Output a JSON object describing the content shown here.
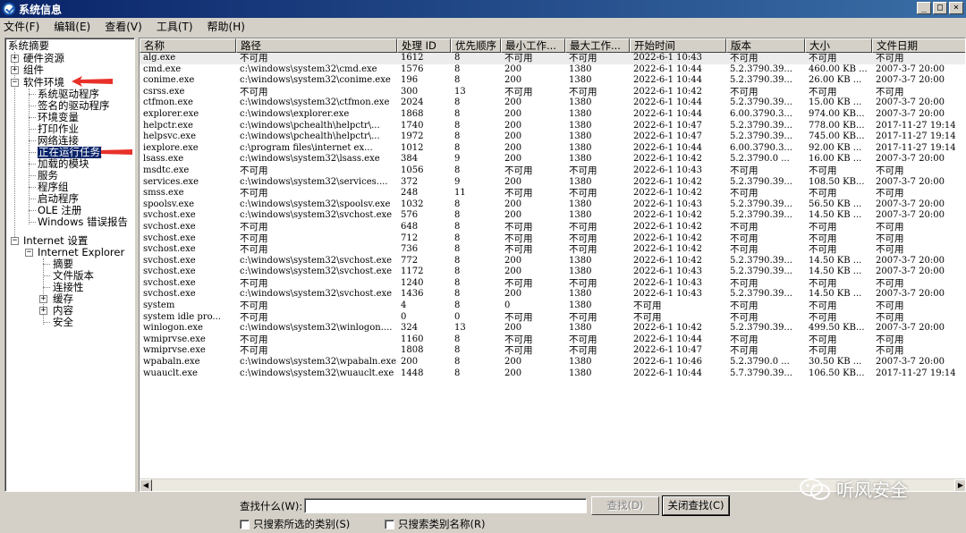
{
  "window": {
    "title": "系统信息"
  },
  "menu": [
    "文件(F)",
    "编辑(E)",
    "查看(V)",
    "工具(T)",
    "帮助(H)"
  ],
  "tree": {
    "root": "系统摘要",
    "hardware": "硬件资源",
    "components": "组件",
    "software_env": "软件环境",
    "software_children": [
      "系统驱动程序",
      "签名的驱动程序",
      "环境变量",
      "打印作业",
      "网络连接",
      "正在运行任务",
      "加载的模块",
      "服务",
      "程序组",
      "启动程序",
      "OLE 注册",
      "Windows 错误报告"
    ],
    "ie_settings": "Internet 设置",
    "ie": "Internet Explorer",
    "ie_children": [
      "摘要",
      "文件版本",
      "连接性",
      "缓存",
      "内容",
      "安全"
    ]
  },
  "table": {
    "columns": [
      "名称",
      "路径",
      "处理 ID",
      "优先顺序",
      "最小工作...",
      "最大工作...",
      "开始时间",
      "版本",
      "大小",
      "文件日期"
    ],
    "rows": [
      [
        "alg.exe",
        "不可用",
        "1612",
        "8",
        "不可用",
        "不可用",
        "2022-6-1 10:43",
        "不可用",
        "不可用",
        "不可用"
      ],
      [
        "cmd.exe",
        "c:\\windows\\system32\\cmd.exe",
        "1576",
        "8",
        "200",
        "1380",
        "2022-6-1 10:44",
        "5.2.3790.39...",
        "460.00 KB ...",
        "2007-3-7 20:00"
      ],
      [
        "conime.exe",
        "c:\\windows\\system32\\conime.exe",
        "196",
        "8",
        "200",
        "1380",
        "2022-6-1 10:44",
        "5.2.3790.39...",
        "26.00 KB ...",
        "2007-3-7 20:00"
      ],
      [
        "csrss.exe",
        "不可用",
        "300",
        "13",
        "不可用",
        "不可用",
        "2022-6-1 10:42",
        "不可用",
        "不可用",
        "不可用"
      ],
      [
        "ctfmon.exe",
        "c:\\windows\\system32\\ctfmon.exe",
        "2024",
        "8",
        "200",
        "1380",
        "2022-6-1 10:44",
        "5.2.3790.39...",
        "15.00 KB ...",
        "2007-3-7 20:00"
      ],
      [
        "explorer.exe",
        "c:\\windows\\explorer.exe",
        "1868",
        "8",
        "200",
        "1380",
        "2022-6-1 10:44",
        "6.00.3790.3...",
        "974.00 KB...",
        "2007-3-7 20:00"
      ],
      [
        "helpctr.exe",
        "c:\\windows\\pchealth\\helpctr\\...",
        "1740",
        "8",
        "200",
        "1380",
        "2022-6-1 10:47",
        "5.2.3790.39...",
        "778.00 KB...",
        "2017-11-27 19:14"
      ],
      [
        "helpsvc.exe",
        "c:\\windows\\pchealth\\helpctr\\...",
        "1972",
        "8",
        "200",
        "1380",
        "2022-6-1 10:47",
        "5.2.3790.39...",
        "745.00 KB...",
        "2017-11-27 19:14"
      ],
      [
        "iexplore.exe",
        "c:\\program files\\internet ex...",
        "1012",
        "8",
        "200",
        "1380",
        "2022-6-1 10:44",
        "6.00.3790.3...",
        "92.00 KB ...",
        "2017-11-27 19:14"
      ],
      [
        "lsass.exe",
        "c:\\windows\\system32\\lsass.exe",
        "384",
        "9",
        "200",
        "1380",
        "2022-6-1 10:42",
        "5.2.3790.0 ...",
        "16.00 KB ...",
        "2007-3-7 20:00"
      ],
      [
        "msdtc.exe",
        "不可用",
        "1056",
        "8",
        "不可用",
        "不可用",
        "2022-6-1 10:43",
        "不可用",
        "不可用",
        "不可用"
      ],
      [
        "services.exe",
        "c:\\windows\\system32\\services....",
        "372",
        "9",
        "200",
        "1380",
        "2022-6-1 10:42",
        "5.2.3790.39...",
        "108.50 KB...",
        "2007-3-7 20:00"
      ],
      [
        "smss.exe",
        "不可用",
        "248",
        "11",
        "不可用",
        "不可用",
        "2022-6-1 10:42",
        "不可用",
        "不可用",
        "不可用"
      ],
      [
        "spoolsv.exe",
        "c:\\windows\\system32\\spoolsv.exe",
        "1032",
        "8",
        "200",
        "1380",
        "2022-6-1 10:43",
        "5.2.3790.39...",
        "56.50 KB ...",
        "2007-3-7 20:00"
      ],
      [
        "svchost.exe",
        "c:\\windows\\system32\\svchost.exe",
        "576",
        "8",
        "200",
        "1380",
        "2022-6-1 10:42",
        "5.2.3790.39...",
        "14.50 KB ...",
        "2007-3-7 20:00"
      ],
      [
        "svchost.exe",
        "不可用",
        "648",
        "8",
        "不可用",
        "不可用",
        "2022-6-1 10:42",
        "不可用",
        "不可用",
        "不可用"
      ],
      [
        "svchost.exe",
        "不可用",
        "712",
        "8",
        "不可用",
        "不可用",
        "2022-6-1 10:42",
        "不可用",
        "不可用",
        "不可用"
      ],
      [
        "svchost.exe",
        "不可用",
        "736",
        "8",
        "不可用",
        "不可用",
        "2022-6-1 10:42",
        "不可用",
        "不可用",
        "不可用"
      ],
      [
        "svchost.exe",
        "c:\\windows\\system32\\svchost.exe",
        "772",
        "8",
        "200",
        "1380",
        "2022-6-1 10:42",
        "5.2.3790.39...",
        "14.50 KB ...",
        "2007-3-7 20:00"
      ],
      [
        "svchost.exe",
        "c:\\windows\\system32\\svchost.exe",
        "1172",
        "8",
        "200",
        "1380",
        "2022-6-1 10:43",
        "5.2.3790.39...",
        "14.50 KB ...",
        "2007-3-7 20:00"
      ],
      [
        "svchost.exe",
        "不可用",
        "1240",
        "8",
        "不可用",
        "不可用",
        "2022-6-1 10:43",
        "不可用",
        "不可用",
        "不可用"
      ],
      [
        "svchost.exe",
        "c:\\windows\\system32\\svchost.exe",
        "1436",
        "8",
        "200",
        "1380",
        "2022-6-1 10:43",
        "5.2.3790.39...",
        "14.50 KB ...",
        "2007-3-7 20:00"
      ],
      [
        "system",
        "不可用",
        "4",
        "8",
        "0",
        "1380",
        "不可用",
        "不可用",
        "不可用",
        "不可用"
      ],
      [
        "system idle pro...",
        "不可用",
        "0",
        "0",
        "不可用",
        "不可用",
        "不可用",
        "不可用",
        "不可用",
        "不可用"
      ],
      [
        "winlogon.exe",
        "c:\\windows\\system32\\winlogon....",
        "324",
        "13",
        "200",
        "1380",
        "2022-6-1 10:42",
        "5.2.3790.39...",
        "499.50 KB...",
        "2007-3-7 20:00"
      ],
      [
        "wmiprvse.exe",
        "不可用",
        "1160",
        "8",
        "不可用",
        "不可用",
        "2022-6-1 10:44",
        "不可用",
        "不可用",
        "不可用"
      ],
      [
        "wmiprvse.exe",
        "不可用",
        "1808",
        "8",
        "不可用",
        "不可用",
        "2022-6-1 10:47",
        "不可用",
        "不可用",
        "不可用"
      ],
      [
        "wpabaln.exe",
        "c:\\windows\\system32\\wpabaln.exe",
        "200",
        "8",
        "200",
        "1380",
        "2022-6-1 10:46",
        "5.2.3790.0 ...",
        "30.50 KB ...",
        "2007-3-7 20:00"
      ],
      [
        "wuauclt.exe",
        "c:\\windows\\system32\\wuauclt.exe",
        "1448",
        "8",
        "200",
        "1380",
        "2022-6-1 10:44",
        "5.7.3790.39...",
        "106.50 KB...",
        "2017-11-27 19:14"
      ]
    ]
  },
  "find": {
    "label": "查找什么(W):",
    "value": "",
    "find_button": "查找(D)",
    "close_button": "关闭查找(C)",
    "check_selected": "只搜索所选的类别(S)",
    "check_names": "只搜索类别名称(R)"
  },
  "watermark": "听风安全",
  "colors": {
    "titlebar": "#0a246a",
    "selection": "#0a246a",
    "arrow": "#e8312a"
  }
}
